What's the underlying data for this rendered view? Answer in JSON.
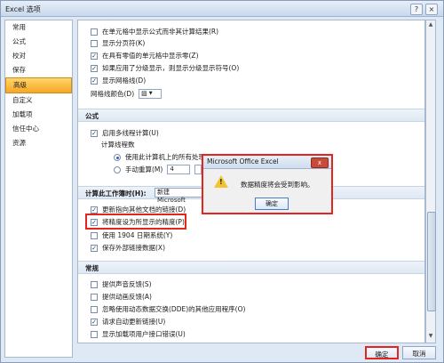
{
  "window": {
    "title": "Excel 选项"
  },
  "sidebar": {
    "items": [
      {
        "label": "常用"
      },
      {
        "label": "公式"
      },
      {
        "label": "校对"
      },
      {
        "label": "保存"
      },
      {
        "label": "高级",
        "active": true
      },
      {
        "label": "自定义"
      },
      {
        "label": "加载项"
      },
      {
        "label": "信任中心"
      },
      {
        "label": "资源"
      }
    ]
  },
  "display_options": {
    "show_formulas": "在单元格中显示公式而非其计算结果(R)",
    "show_page_breaks": "显示分页符(K)",
    "show_zero": "在具有零值的单元格中显示零(Z)",
    "show_outline": "如果应用了分级显示，则显示分级显示符号(O)",
    "show_gridlines": "显示网格线(D)",
    "gridline_color": "网格线颜色(D)"
  },
  "formulas": {
    "header": "公式",
    "multithread": "启用多线程计算(U)",
    "threads_label": "计算线程数",
    "use_all": "使用此计算机上的所有处理器(P): 4",
    "manual": "手动重算(M)",
    "manual_value": "4"
  },
  "workbook_calc": {
    "label": "计算此工作簿时(H):",
    "workbook_name": "新建 Microsoft",
    "update_links": "更新指向其他文档的链接(D)",
    "set_precision": "将精度设为所显示的精度(P)",
    "use_1904": "使用 1904 日期系统(Y)",
    "save_external": "保存外部链接数据(X)"
  },
  "general": {
    "header": "常规",
    "sound": "提供声音反馈(S)",
    "animation": "提供动画反馈(A)",
    "ignore_dde": "忽略使用动态数据交换(DDE)的其他应用程序(O)",
    "auto_update": "请求自动更新链接(U)",
    "show_addin_errors": "显示加载项用户接口错误(U)"
  },
  "dialog": {
    "title": "Microsoft Office Excel",
    "message": "数据精度将会受到影响。",
    "ok": "确定",
    "close": "x"
  },
  "footer": {
    "ok": "确定",
    "cancel": "取消"
  },
  "colors": {
    "accent": "#f6a726",
    "highlight": "#e2261d"
  }
}
